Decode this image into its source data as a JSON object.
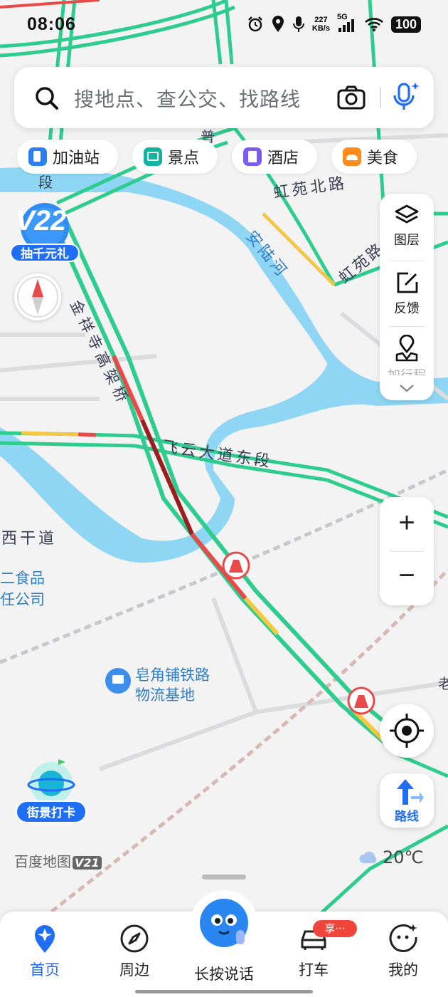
{
  "status_bar": {
    "time": "08:06",
    "net_speed_value": "227",
    "net_speed_unit": "KB/s",
    "network": "5G",
    "battery": "100"
  },
  "search": {
    "placeholder": "搜地点、查公交、找路线"
  },
  "categories": [
    {
      "label": "加油站",
      "icon": "gas-station-icon",
      "color": "#2a7ef6"
    },
    {
      "label": "景点",
      "icon": "scenic-icon",
      "color": "#12b3a0"
    },
    {
      "label": "酒店",
      "icon": "hotel-icon",
      "color": "#7b5cf0"
    },
    {
      "label": "美食",
      "icon": "food-icon",
      "color": "#ff8a1c"
    }
  ],
  "right_panel": {
    "layers": "图层",
    "feedback": "反馈",
    "third": "加行程"
  },
  "zoom": {
    "in": "+",
    "out": "−"
  },
  "route_button": "路线",
  "promo": {
    "version": "V22",
    "label": "抽千元礼"
  },
  "street_view": {
    "label": "街景打卡"
  },
  "map_labels": {
    "hongyuan_north": "虹苑北路",
    "hongyuan_road": "虹苑路",
    "river": "安陆河",
    "expressway": "金祥寺高架桥",
    "feiyun": "飞云大道东段",
    "west_road": "西干道",
    "company_1": "二食品",
    "company_2": "任公司",
    "poi_1": "皂角铺铁路",
    "poi_2": "物流基地",
    "pu": "普",
    "duan": "段",
    "lao": "老"
  },
  "watermark": {
    "text": "百度地图",
    "version": "V21"
  },
  "weather": {
    "temp": "20℃"
  },
  "tabs": [
    {
      "label": "首页",
      "active": true
    },
    {
      "label": "周边",
      "active": false
    },
    {
      "label": "长按说话",
      "active": false
    },
    {
      "label": "打车",
      "active": false
    },
    {
      "label": "我的",
      "active": false
    }
  ],
  "share_badge": "享···",
  "colors": {
    "accent": "#1f6ef5",
    "road_green": "#2ecc8f",
    "road_red": "#e84a4a",
    "road_yellow": "#f5c842",
    "water": "#8ed6f3"
  }
}
